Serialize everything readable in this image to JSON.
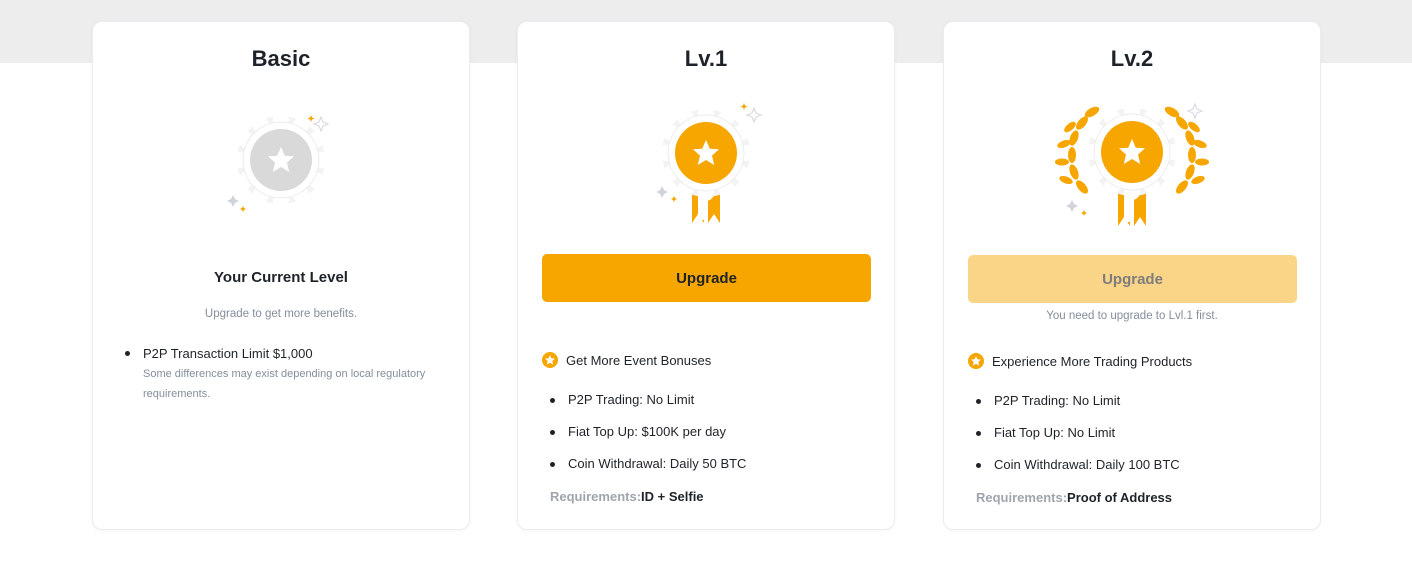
{
  "cards": [
    {
      "title": "Basic",
      "status": "Your Current Level",
      "hint": "Upgrade to get more benefits.",
      "limits": [
        {
          "text": "P2P Transaction Limit $1,000",
          "note": "Some differences may exist depending on local regulatory requirements."
        }
      ]
    },
    {
      "title": "Lv.1",
      "button": "Upgrade",
      "benefit": "Get More Event Bonuses",
      "features": [
        "P2P Trading: No Limit",
        "Fiat Top Up: $100K per day",
        "Coin Withdrawal: Daily 50 BTC"
      ],
      "requirements_label": "Requirements:",
      "requirements_value": "ID + Selfie"
    },
    {
      "title": "Lv.2",
      "button": "Upgrade",
      "hint": "You need to upgrade to Lvl.1 first.",
      "benefit": "Experience More Trading Products",
      "features": [
        "P2P Trading: No Limit",
        "Fiat Top Up: No Limit",
        "Coin Withdrawal: Daily 100 BTC"
      ],
      "requirements_label": "Requirements:",
      "requirements_value": "Proof of Address"
    }
  ],
  "colors": {
    "accent": "#f7a600",
    "accent_disabled": "#fbd587",
    "silver": "#d6d6d6",
    "text": "#1e2329",
    "muted": "#848e9c"
  },
  "icons": {
    "basic_badge": "silver-star-medal-icon",
    "lv1_badge": "gold-ribbon-medal-icon",
    "lv2_badge": "laurel-gold-medal-icon",
    "benefit": "star-circle-icon"
  }
}
